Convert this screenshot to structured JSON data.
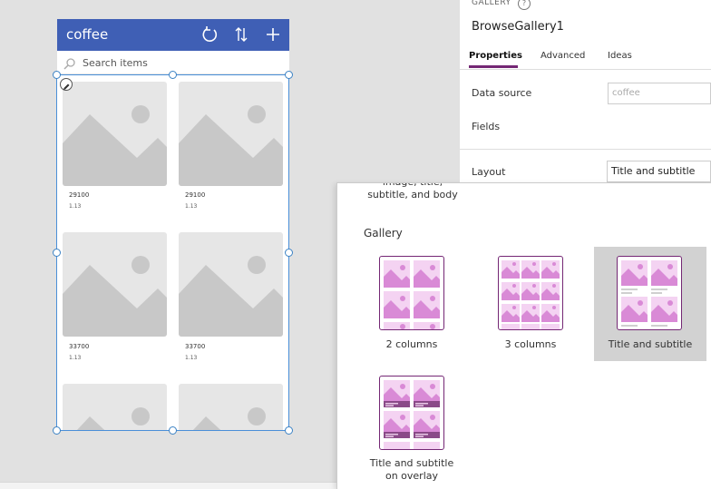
{
  "app": {
    "title": "coffee",
    "search_placeholder": "Search items",
    "header_icons": [
      "refresh-icon",
      "sort-icon",
      "add-icon"
    ],
    "accent": "#3f5fb5"
  },
  "gallery_items": [
    {
      "title": "29100",
      "subtitle": "1.13"
    },
    {
      "title": "29100",
      "subtitle": "1.13"
    },
    {
      "title": "33700",
      "subtitle": "1.13"
    },
    {
      "title": "33700",
      "subtitle": "1.13"
    }
  ],
  "panel": {
    "kicker": "GALLERY",
    "help": "?",
    "name": "BrowseGallery1",
    "tabs": [
      "Properties",
      "Advanced",
      "Ideas"
    ],
    "data_source_label": "Data source",
    "data_source_value": "coffee",
    "fields_label": "Fields",
    "layout_label": "Layout",
    "layout_value": "Title and subtitle",
    "brand_color": "#742774"
  },
  "layout_dropdown": {
    "previous_option_label": "image, title, subtitle, and body",
    "section_title": "Gallery",
    "options": [
      {
        "label": "2 columns",
        "selected": false
      },
      {
        "label": "3 columns",
        "selected": false
      },
      {
        "label": "Title and subtitle",
        "selected": true
      },
      {
        "label": "Title and subtitle on overlay",
        "selected": false
      }
    ]
  }
}
